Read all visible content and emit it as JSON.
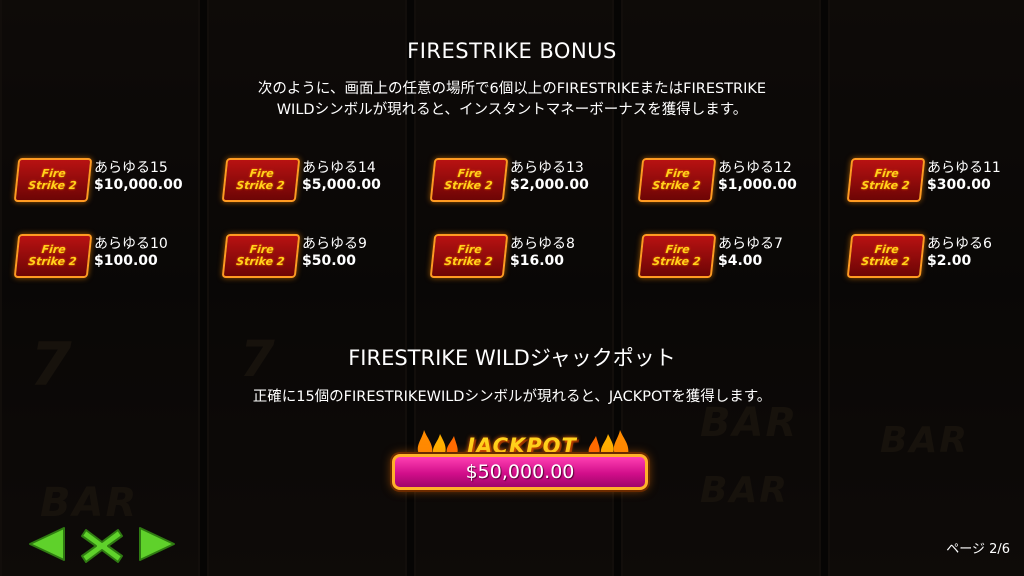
{
  "bonus": {
    "title": "FIRESTRIKE BONUS",
    "desc_line1": "次のように、画面上の任意の場所で6個以上のFIRESTRIKEまたはFIRESTRIKE",
    "desc_line2": "WILDシンボルが現れると、インスタントマネーボーナスを獲得します。"
  },
  "logo": {
    "line1": "Fire",
    "line2": "Strike 2",
    "icon": "firestrike-logo-icon"
  },
  "payouts": [
    {
      "label": "あらゆる15",
      "amount": "$10,000.00"
    },
    {
      "label": "あらゆる14",
      "amount": "$5,000.00"
    },
    {
      "label": "あらゆる13",
      "amount": "$2,000.00"
    },
    {
      "label": "あらゆる12",
      "amount": "$1,000.00"
    },
    {
      "label": "あらゆる11",
      "amount": "$300.00"
    },
    {
      "label": "あらゆる10",
      "amount": "$100.00"
    },
    {
      "label": "あらゆる9",
      "amount": "$50.00"
    },
    {
      "label": "あらゆる8",
      "amount": "$16.00"
    },
    {
      "label": "あらゆる7",
      "amount": "$4.00"
    },
    {
      "label": "あらゆる6",
      "amount": "$2.00"
    }
  ],
  "wild": {
    "title": "FIRESTRIKE WILDジャックポット",
    "desc": "正確に15個のFIRESTRIKEWILDシンボルが現れると、JACKPOTを獲得します。"
  },
  "jackpot": {
    "label": "JACKPOT",
    "value": "$50,000.00"
  },
  "nav": {
    "prev_icon": "arrow-left-icon",
    "close_icon": "close-icon",
    "next_icon": "arrow-right-icon",
    "page_indicator": "ページ 2/6"
  },
  "colors": {
    "accent_green": "#5fd12b",
    "jackpot_pink": "#e0179a",
    "logo_red": "#b81212",
    "logo_gold": "#ffd21c"
  }
}
